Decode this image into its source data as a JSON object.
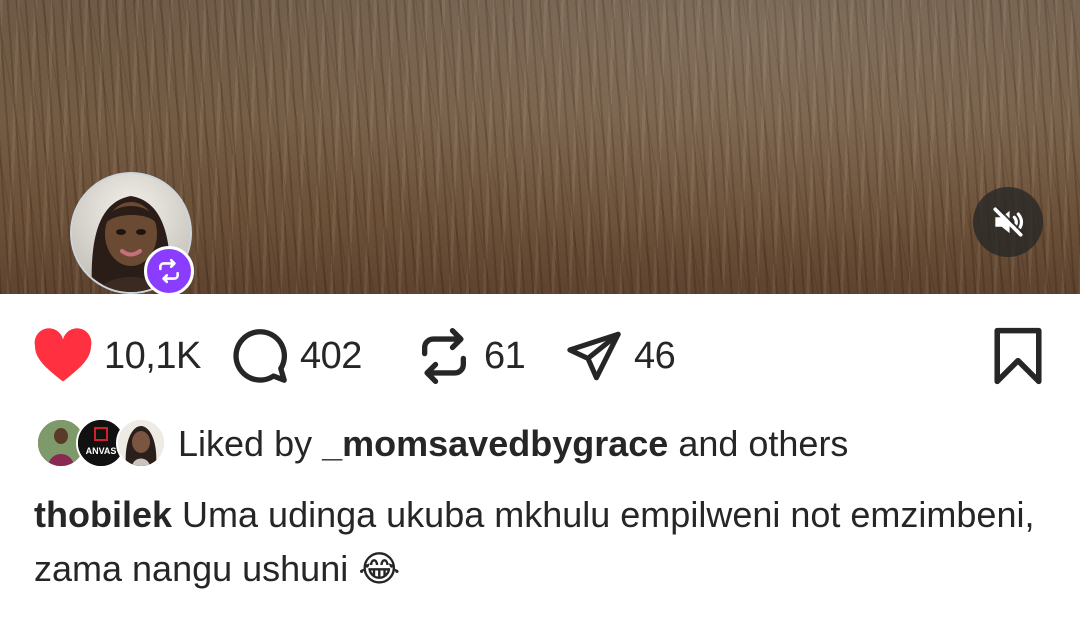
{
  "post": {
    "media": {
      "mute_icon": "speaker-muted-icon",
      "author_avatar_icon": "profile-photo",
      "repost_badge_icon": "repost-icon",
      "repost_badge_color": "#8b3dff"
    },
    "actions": {
      "likes": "10,1K",
      "comments": "402",
      "reposts": "61",
      "shares": "46",
      "like_color": "#ff3040"
    },
    "liked_by": {
      "prefix": "Liked by",
      "username": "_momsavedbygrace",
      "suffix": "and others",
      "avatar_logo_text": "ANVAS"
    },
    "caption": {
      "username": "thobilek",
      "text": "Uma udinga ukuba mkhulu empilweni not emzimbeni, zama nangu ushuni",
      "emoji": "😂"
    }
  }
}
